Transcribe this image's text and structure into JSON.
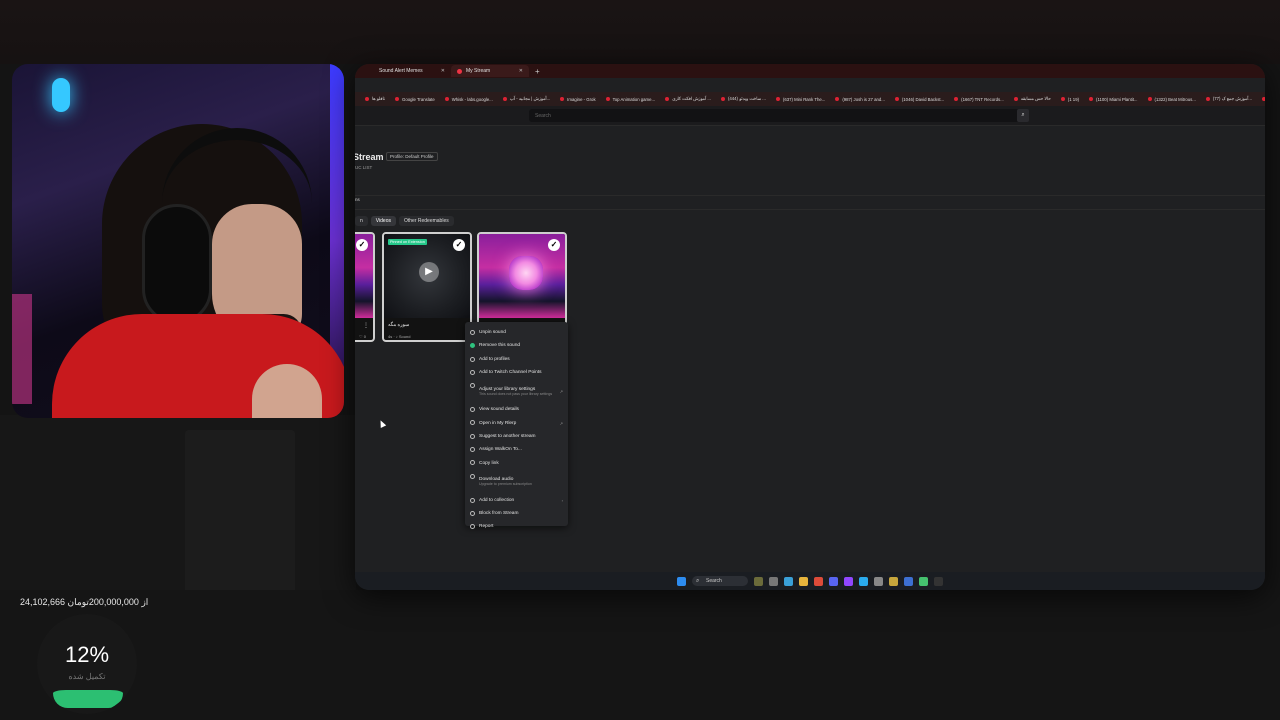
{
  "browser": {
    "tabs": [
      {
        "label": "Sound Alert Memes",
        "active": false
      },
      {
        "label": "My Stream",
        "active": true
      }
    ],
    "new_tab": "+",
    "bookmarks": [
      "نافلو ها",
      "Google Translate",
      "Whisk - labs.google...",
      "آموزش | مجانيه - آپ...",
      "Imagine - Grok",
      "Top Animation game...",
      "آموزش افکت کاری ...",
      "(444) ساخت ویدئو ...",
      "(637) Mini Rank The...",
      "(987) Josh is 27 and...",
      "(1046) David Backst...",
      "(1667) TNT Records...",
      "حالا حس مسابقه",
      "(1 19)",
      "(1100) Miami Plantit...",
      "(1322) Beat Mitrous...",
      "(77) آموزش جمع ک...",
      "این کار شمبه شناخت ب"
    ],
    "search_placeholder": "Search",
    "search_icon": "search-icon"
  },
  "page": {
    "title": "Stream",
    "profile_badge": "Profile: Default Profile",
    "subtitle": "UC LIST",
    "section_label": "ns",
    "categories": [
      {
        "label": "n",
        "selected": false
      },
      {
        "label": "Videos",
        "selected": true
      },
      {
        "label": "Other Redeemables",
        "selected": false
      }
    ]
  },
  "cards": [
    {
      "name": "",
      "meta": "♡ 0",
      "check": "✓"
    },
    {
      "name": "سوره مگه",
      "meta": "4s · ♪ Sound",
      "badge": "Pinned on Extension",
      "check": "✓",
      "play": "▶"
    },
    {
      "name": "",
      "meta": "",
      "check": "✓"
    }
  ],
  "context_menu": [
    {
      "label": "Unpin sound",
      "icon": "pin-icon"
    },
    {
      "label": "Remove this sound",
      "icon": "check-circle-icon"
    },
    {
      "label": "Add to profiles",
      "icon": "plus-icon"
    },
    {
      "label": "Add to Twitch Channel Points",
      "icon": "points-icon"
    },
    {
      "label": "Adjust your library settings",
      "sub": "This sound does not pass your library settings",
      "icon": "settings-icon",
      "external": true
    },
    {
      "label": "View sound details",
      "icon": "list-icon"
    },
    {
      "label": "Open in My Rlerp",
      "icon": "open-icon",
      "external": true
    },
    {
      "label": "Suggest to another stream",
      "icon": "share-icon"
    },
    {
      "label": "Assign WalkOn To...",
      "icon": "walk-icon"
    },
    {
      "label": "Copy link",
      "icon": "link-icon"
    },
    {
      "label": "Download audio",
      "sub": "Upgrade to premium subscription",
      "icon": "download-icon"
    },
    {
      "label": "Add to collection",
      "icon": "collection-icon",
      "arrow": "›"
    },
    {
      "label": "Block from Stream",
      "icon": "block-icon"
    },
    {
      "label": "Report",
      "icon": "report-icon"
    }
  ],
  "taskbar": {
    "search_label": "Search"
  },
  "overlay": {
    "donation_text": "24,102,666  از 200,000,000تومان",
    "percent": "12%",
    "percent_label": "تکمیل شده",
    "progress_value": 0.12
  },
  "colors": {
    "accent_green": "#2cbf72",
    "tab_bar": "#2b1111",
    "pinned_badge": "#25c88a"
  }
}
